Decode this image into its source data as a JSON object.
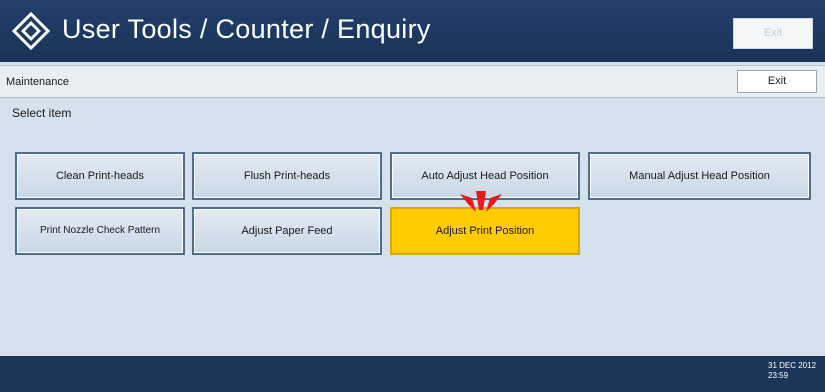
{
  "header": {
    "title": "User Tools / Counter / Enquiry",
    "exit_label": "Exit",
    "logo_icon": "diamond-logo-icon"
  },
  "maintenance": {
    "label": "Maintenance",
    "exit_label": "Exit"
  },
  "instruction": "Select item",
  "items": [
    {
      "label": "Clean Print-heads",
      "selected": false
    },
    {
      "label": "Flush Print-heads",
      "selected": false
    },
    {
      "label": "Auto Adjust Head Position",
      "selected": false
    },
    {
      "label": "Manual Adjust Head Position",
      "selected": false
    },
    {
      "label": "Print Nozzle Check Pattern",
      "selected": false
    },
    {
      "label": "Adjust Paper Feed",
      "selected": false
    },
    {
      "label": "Adjust Print Position",
      "selected": true
    }
  ],
  "footer": {
    "date": "31 DEC 2012",
    "time": "23:59"
  },
  "colors": {
    "title_bar": "#1a3358",
    "selected_item": "#ffcc00",
    "background": "#d5e1ec",
    "pointer": "#e8191b"
  }
}
